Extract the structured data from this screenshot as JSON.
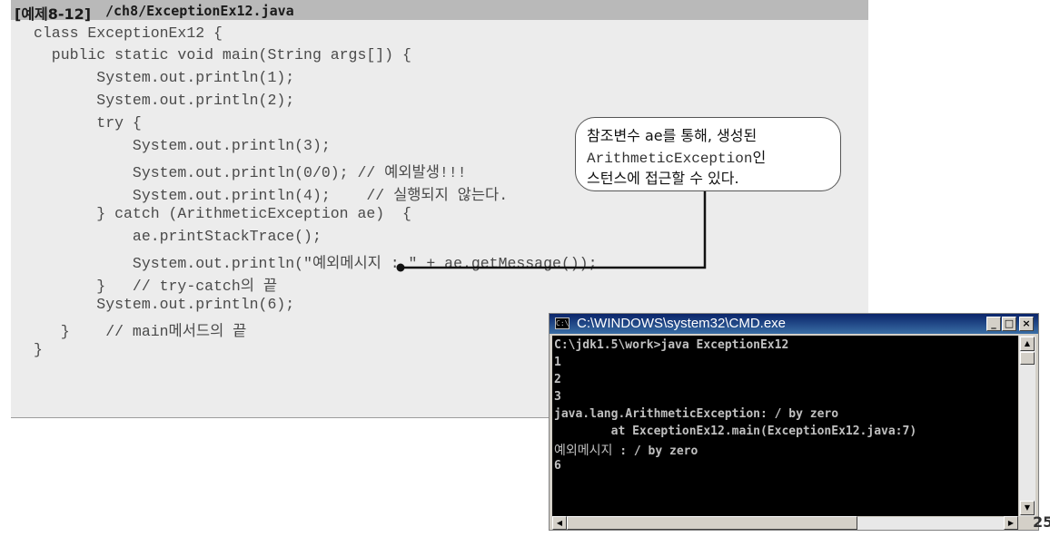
{
  "code_panel": {
    "example_label": "[예제8-12]",
    "file_path": "/ch8/ExceptionEx12.java",
    "lines": [
      "class ExceptionEx12 {",
      "  public static void main(String args[]) {",
      "       System.out.println(1);",
      "       System.out.println(2);",
      "       try {",
      "           System.out.println(3);",
      "           System.out.println(0/0); // 예외발생!!!",
      "           System.out.println(4);    // 실행되지 않는다.",
      "       } catch (ArithmeticException ae)  {",
      "           ae.printStackTrace();",
      "           System.out.println(\"예외메시지 : \" + ae.getMessage());",
      "       }   // try-catch의 끝",
      "       System.out.println(6);",
      "   }    // main메서드의 끝",
      "}"
    ]
  },
  "callout": {
    "line1": "참조변수 ae를 통해, 생성된",
    "line2_code": "ArithmeticException",
    "line2_suffix": "인",
    "line3": "스턴스에 접근할 수 있다."
  },
  "console_window": {
    "title": "C:\\WINDOWS\\system32\\CMD.exe",
    "minimize": "_",
    "maximize": "□",
    "close": "×",
    "lines": [
      "C:\\jdk1.5\\work>java ExceptionEx12",
      "1",
      "2",
      "3",
      "java.lang.ArithmeticException: / by zero",
      "        at ExceptionEx12.main(ExceptionEx12.java:7)"
    ],
    "kr_line_prefix": "예외메시지",
    "kr_line_suffix": " : / by zero",
    "last_line": "6"
  },
  "page_number": "25"
}
